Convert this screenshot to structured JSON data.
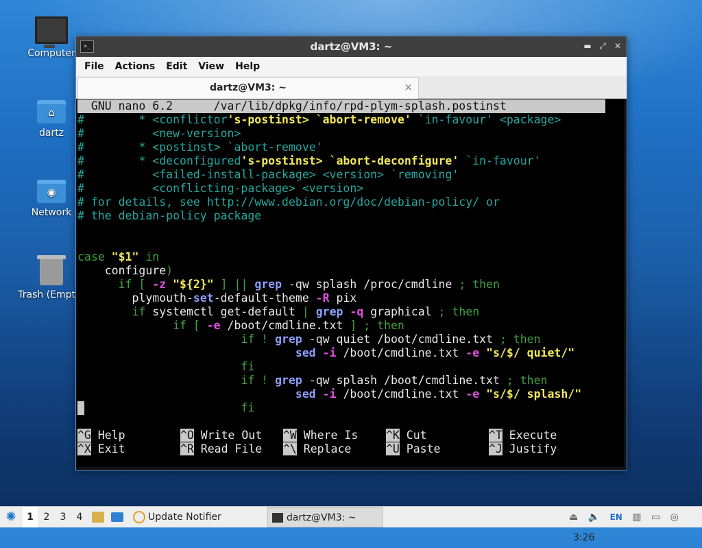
{
  "desktop": {
    "icons": [
      {
        "label": "Computer",
        "icon": "computer-icon"
      },
      {
        "label": "dartz",
        "icon": "home-folder-icon"
      },
      {
        "label": "Network",
        "icon": "network-folder-icon"
      },
      {
        "label": "Trash (Empty)",
        "icon": "trash-icon"
      }
    ]
  },
  "window": {
    "title": "dartz@VM3: ~",
    "menu": [
      "File",
      "Actions",
      "Edit",
      "View",
      "Help"
    ],
    "tab_title": "dartz@VM3: ~",
    "tab_close": "×"
  },
  "nano": {
    "header": "  GNU nano 6.2      /var/lib/dpkg/info/rpd-plym-splash.postinst",
    "lines": [
      [
        [
          "c",
          "#        * <conflictor"
        ],
        [
          "y",
          "'s-postinst> `abort-remove'"
        ],
        [
          "c",
          " `in-favour' <package>"
        ]
      ],
      [
        [
          "c",
          "#          <new-version>"
        ]
      ],
      [
        [
          "c",
          "#        * <postinst> `abort-remove'"
        ]
      ],
      [
        [
          "c",
          "#        * <deconfigured"
        ],
        [
          "y",
          "'s-postinst> `abort-deconfigure'"
        ],
        [
          "c",
          " `in-favour'"
        ]
      ],
      [
        [
          "c",
          "#          <failed-install-package> <version> `removing'"
        ]
      ],
      [
        [
          "c",
          "#          <conflicting-package> <version>"
        ]
      ],
      [
        [
          "c",
          "# for details, see http://www.debian.org/doc/debian-policy/ or"
        ]
      ],
      [
        [
          "c",
          "# the debian-policy package"
        ]
      ],
      [],
      [],
      [
        [
          "g",
          "case "
        ],
        [
          "y",
          "\"$1\""
        ],
        [
          "g",
          " in"
        ]
      ],
      [
        [
          "w",
          "    configure"
        ],
        [
          "g",
          ")"
        ]
      ],
      [
        [
          "g",
          "      if [ "
        ],
        [
          "m",
          "-z"
        ],
        [
          "w",
          " "
        ],
        [
          "y",
          "\"${2}\""
        ],
        [
          "g",
          " ] || "
        ],
        [
          "b",
          "grep"
        ],
        [
          "w",
          " -qw splash /proc/cmdline "
        ],
        [
          "g",
          "; then"
        ]
      ],
      [
        [
          "w",
          "        plymouth-"
        ],
        [
          "b",
          "set"
        ],
        [
          "w",
          "-default-theme "
        ],
        [
          "m",
          "-R"
        ],
        [
          "w",
          " pix"
        ]
      ],
      [
        [
          "g",
          "        if "
        ],
        [
          "w",
          "systemctl get-default "
        ],
        [
          "g",
          "| "
        ],
        [
          "b",
          "grep"
        ],
        [
          "w",
          " "
        ],
        [
          "m",
          "-q"
        ],
        [
          "w",
          " graphical "
        ],
        [
          "g",
          "; then"
        ]
      ],
      [
        [
          "g",
          "              if [ "
        ],
        [
          "m",
          "-e"
        ],
        [
          "w",
          " /boot/cmdline.txt "
        ],
        [
          "g",
          "] ; then"
        ]
      ],
      [
        [
          "g",
          "                        if ! "
        ],
        [
          "b",
          "grep"
        ],
        [
          "w",
          " -qw quiet /boot/cmdline.txt "
        ],
        [
          "g",
          "; then"
        ]
      ],
      [
        [
          "w",
          "                                "
        ],
        [
          "b",
          "sed"
        ],
        [
          "w",
          " "
        ],
        [
          "m",
          "-i"
        ],
        [
          "w",
          " /boot/cmdline.txt "
        ],
        [
          "m",
          "-e"
        ],
        [
          "w",
          " "
        ],
        [
          "y",
          "\"s/$/ quiet/\""
        ]
      ],
      [
        [
          "g",
          "                        fi"
        ]
      ],
      [
        [
          "g",
          "                        if ! "
        ],
        [
          "b",
          "grep"
        ],
        [
          "w",
          " -qw splash /boot/cmdline.txt "
        ],
        [
          "g",
          "; then"
        ]
      ],
      [
        [
          "w",
          "                                "
        ],
        [
          "b",
          "sed"
        ],
        [
          "w",
          " "
        ],
        [
          "m",
          "-i"
        ],
        [
          "w",
          " /boot/cmdline.txt "
        ],
        [
          "m",
          "-e"
        ],
        [
          "w",
          " "
        ],
        [
          "y",
          "\"s/$/ splash/\""
        ]
      ],
      [
        [
          "cursor",
          ""
        ],
        [
          "g",
          "                       fi"
        ]
      ]
    ],
    "shortcuts": [
      [
        [
          "^G",
          "Help"
        ],
        [
          "^O",
          "Write Out"
        ],
        [
          "^W",
          "Where Is"
        ],
        [
          "^K",
          "Cut"
        ],
        [
          "^T",
          "Execute"
        ]
      ],
      [
        [
          "^X",
          "Exit"
        ],
        [
          "^R",
          "Read File"
        ],
        [
          "^\\",
          "Replace"
        ],
        [
          "^U",
          "Paste"
        ],
        [
          "^J",
          "Justify"
        ]
      ]
    ]
  },
  "taskbar": {
    "workspaces": [
      "1",
      "2",
      "3",
      "4"
    ],
    "active_workspace": "1",
    "update_notifier": "Update Notifier",
    "task_title": "dartz@VM3: ~",
    "keyboard_layout": "EN",
    "clock": "3:26"
  }
}
